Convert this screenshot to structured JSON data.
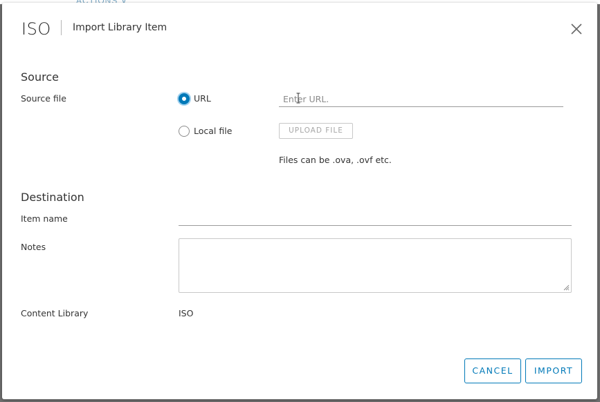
{
  "backdrop": {
    "partial_text": "ACTIONS ∨"
  },
  "dialog": {
    "title": "ISO",
    "subtitle": "Import Library Item",
    "close_icon": "close-icon"
  },
  "source": {
    "section_title": "Source",
    "source_file_label": "Source file",
    "options": [
      {
        "label": "URL",
        "selected": true
      },
      {
        "label": "Local file",
        "selected": false
      }
    ],
    "url_input": {
      "value": "",
      "placeholder": "Enter URL."
    },
    "upload_button_label": "UPLOAD FILE",
    "hint": "Files can be .ova, .ovf etc."
  },
  "destination": {
    "section_title": "Destination",
    "item_name_label": "Item name",
    "item_name_value": "",
    "notes_label": "Notes",
    "notes_value": "",
    "content_library_label": "Content Library",
    "content_library_value": "ISO"
  },
  "footer": {
    "cancel_label": "CANCEL",
    "import_label": "IMPORT"
  },
  "colors": {
    "accent": "#0079b8",
    "radio_focus": "#9fd0ee",
    "overlay": "#6f6f6f"
  }
}
